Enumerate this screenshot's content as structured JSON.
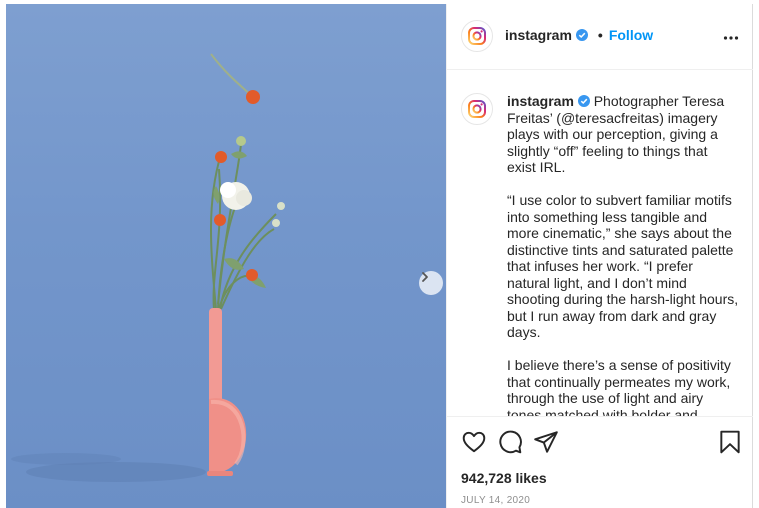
{
  "post": {
    "username": "instagram",
    "follow_label": "Follow",
    "separator": "•",
    "caption_username": "instagram",
    "caption_pre_mention": " Photographer Teresa Freitas’ (",
    "mention": "@teresacfreitas",
    "caption_post_mention": ") imagery plays with our perception, giving a slightly “off” feeling to things that exist IRL.",
    "paragraph_2": "“I use color to subvert familiar motifs into something less tangible and more cinematic,” she says about the distinctive tints and saturated palette that infuses her work. “I prefer natural light, and I don’t mind shooting during the harsh-light hours, but I run away from dark and gray days.",
    "paragraph_3": "I believe there’s a sense of positivity that continually permeates my work, through the use of light and airy tones matched with bolder and stronger hues. Something that can be delicate",
    "likes": "942,728 likes",
    "date": "JULY 14, 2020"
  },
  "icons": {
    "profile": "instagram-logo-icon",
    "verified": "verified-badge-icon",
    "more": "more-options-icon",
    "like": "heart-icon",
    "comment": "comment-icon",
    "share": "share-icon",
    "save": "bookmark-icon",
    "next": "chevron-right-icon"
  },
  "colors": {
    "background_blue": "#7396cb",
    "vase_pink": "#f29a94",
    "follow_blue": "#0095f6",
    "verified_blue": "#3897f0"
  }
}
